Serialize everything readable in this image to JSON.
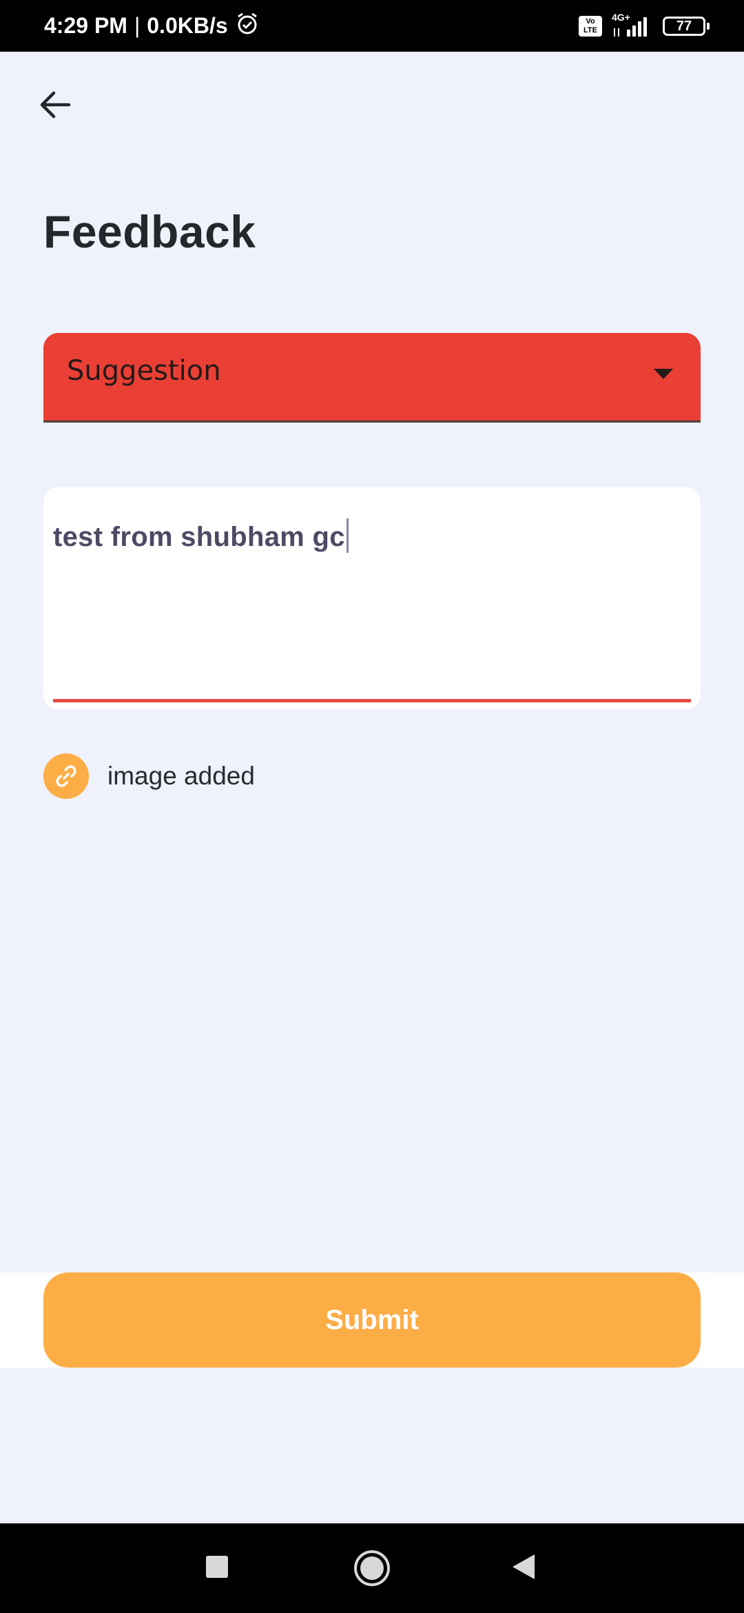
{
  "status_bar": {
    "time": "4:29 PM",
    "separator": "|",
    "speed": "0.0KB/s",
    "volte_top": "Vo",
    "volte_bottom": "LTE",
    "network": "4G+",
    "battery": "77",
    "icons": [
      "alarm-icon",
      "volte-icon",
      "signal-icon",
      "battery-icon"
    ]
  },
  "header": {
    "back_icon": "arrow-left-icon",
    "title": "Feedback"
  },
  "form": {
    "category": {
      "selected": "Suggestion",
      "icon": "dropdown-arrow-icon",
      "color": "#e93f34"
    },
    "message": {
      "value": "test from shubham gc",
      "underline_color": "#e34d45"
    },
    "attachment": {
      "icon": "link-icon",
      "label": "image added",
      "color": "#fdad46"
    },
    "submit": {
      "label": "Submit",
      "color": "#fdad46"
    }
  },
  "nav_bar": {
    "icons": [
      "recents-square-icon",
      "home-circle-icon",
      "back-triangle-icon"
    ]
  }
}
